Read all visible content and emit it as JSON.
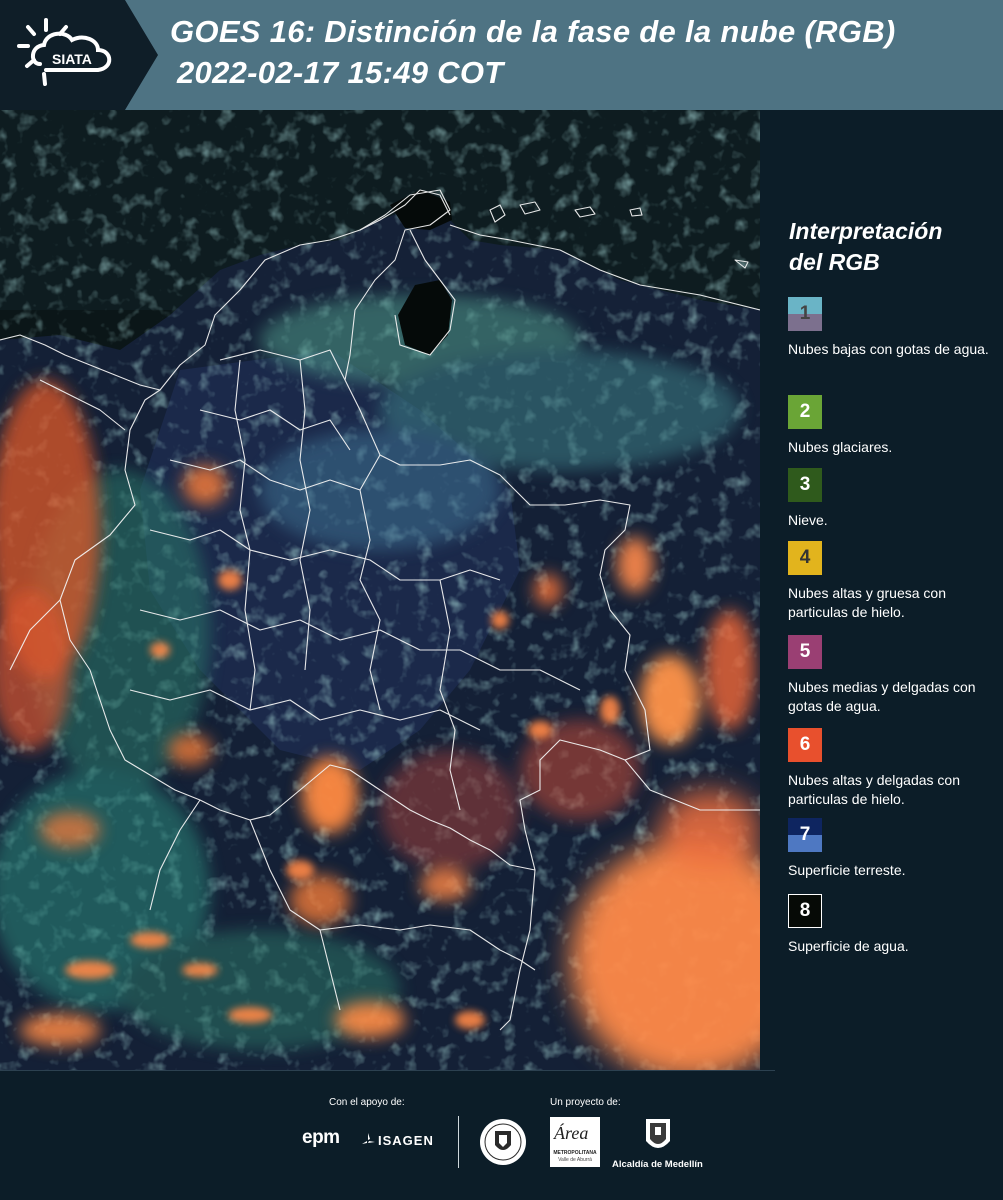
{
  "header": {
    "logo_text": "SIATA",
    "title_line1": "GOES 16: Distinción de la fase de la nube (RGB)",
    "title_line2": "2022-02-17 15:49 COT"
  },
  "legend": {
    "title_line1": "Interpretación",
    "title_line2": "del RGB",
    "items": [
      {
        "number": "1",
        "label": "Nubes bajas con gotas de agua.",
        "color_top": "#6ab4c6",
        "color_bottom": "#7c708e",
        "number_color": "#444444"
      },
      {
        "number": "2",
        "label": "Nubes glaciares.",
        "color_top": "#6aa536",
        "color_bottom": "#6aa536",
        "number_color": "#ffffff"
      },
      {
        "number": "3",
        "label": "Nieve.",
        "color_top": "#2f5a1c",
        "color_bottom": "#2f5a1c",
        "number_color": "#ffffff"
      },
      {
        "number": "4",
        "label": "Nubes altas y gruesa con particulas de hielo.",
        "color_top": "#e2b41d",
        "color_bottom": "#e2b41d",
        "number_color": "#333333"
      },
      {
        "number": "5",
        "label": "Nubes medias y delgadas con gotas de agua.",
        "color_top": "#9a3f73",
        "color_bottom": "#9a3f73",
        "number_color": "#ffffff"
      },
      {
        "number": "6",
        "label": "Nubes altas y delgadas con particulas de hielo.",
        "color_top": "#e8502d",
        "color_bottom": "#e8502d",
        "number_color": "#ffffff"
      },
      {
        "number": "7",
        "label": "Superficie terreste.",
        "color_top": "#0e2560",
        "color_bottom": "#4e78c2",
        "number_color": "#ffffff"
      },
      {
        "number": "8",
        "label": "Superficie de agua.",
        "color_top": "#060a06",
        "color_bottom": "#060a06",
        "number_color": "#ffffff"
      }
    ]
  },
  "footer": {
    "support_label": "Con el apoyo de:",
    "project_label": "Un proyecto de:",
    "sponsor_epm": "epm",
    "sponsor_isagen": "ISAGEN",
    "area_text": "Área",
    "area_sub1": "METROPOLITANA",
    "area_sub2": "Valle de Aburrá",
    "alcaldia": "Alcaldía de Medellín"
  }
}
